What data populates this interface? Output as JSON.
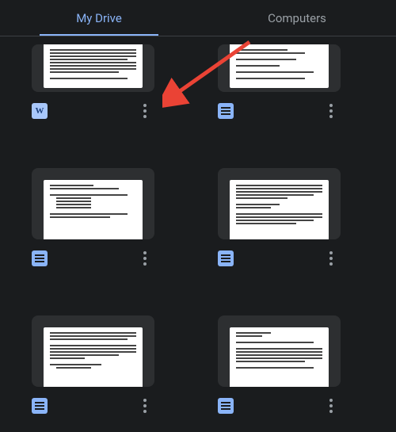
{
  "tabs": {
    "my_drive": "My Drive",
    "computers": "Computers",
    "active": "my_drive"
  },
  "files": [
    {
      "type": "word",
      "thumb_style": "partial"
    },
    {
      "type": "gdoc",
      "thumb_style": "partial"
    },
    {
      "type": "gdoc",
      "thumb_style": "full"
    },
    {
      "type": "gdoc",
      "thumb_style": "full"
    },
    {
      "type": "gdoc",
      "thumb_style": "full"
    },
    {
      "type": "gdoc",
      "thumb_style": "full"
    }
  ],
  "icons": {
    "word_letter": "W"
  },
  "annotation": {
    "arrow_color": "#ea4335"
  }
}
